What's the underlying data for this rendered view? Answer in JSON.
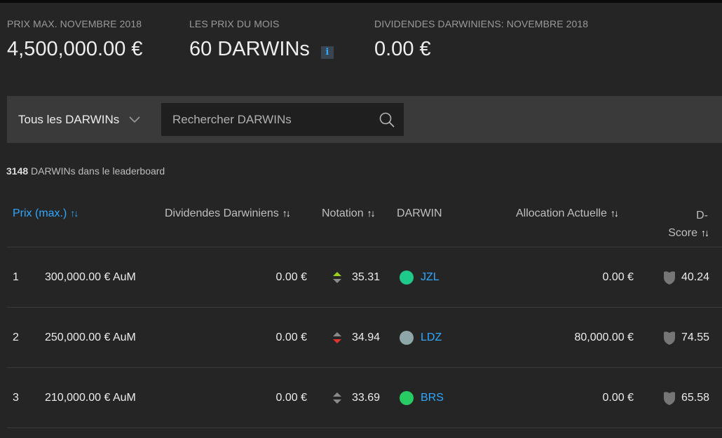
{
  "stats": {
    "max_prize": {
      "label": "PRIX MAX. NOVEMBRE 2018",
      "value": "4,500,000.00 €"
    },
    "month_prizes": {
      "label": "LES PRIX DU MOIS",
      "value": "60 DARWINs",
      "info_icon": "i"
    },
    "dividends": {
      "label": "DIVIDENDES DARWINIENS: NOVEMBRE 2018",
      "value": "0.00 €"
    }
  },
  "filter": {
    "dropdown_label": "Tous les DARWINs",
    "search_placeholder": "Rechercher DARWINs"
  },
  "leaderboard_count": {
    "number": "3148",
    "text": " DARWINs dans le leaderboard"
  },
  "columns": {
    "prize": "Prix (max.)",
    "dividends": "Dividendes Darwiniens",
    "rating": "Notation",
    "darwin": "DARWIN",
    "allocation": "Allocation Actuelle",
    "dscore_line1": "D-",
    "dscore_line2": "Score",
    "sort_glyph": "↑↓"
  },
  "colors": {
    "accent": "#2fa8ff",
    "up": "#9bd11e",
    "down": "#e2332f",
    "neutral": "#8a8a8a"
  },
  "rows": [
    {
      "rank": "1",
      "prize": "300,000.00 € AuM",
      "dividends": "0.00 €",
      "trend": "up",
      "rating": "35.31",
      "dot_color": "#1fc98b",
      "ticker": "JZL",
      "allocation": "0.00 €",
      "dscore": "40.24"
    },
    {
      "rank": "2",
      "prize": "250,000.00 € AuM",
      "dividends": "0.00 €",
      "trend": "down",
      "rating": "34.94",
      "dot_color": "#8fa6a8",
      "ticker": "LDZ",
      "allocation": "80,000.00 €",
      "dscore": "74.55"
    },
    {
      "rank": "3",
      "prize": "210,000.00 € AuM",
      "dividends": "0.00 €",
      "trend": "neutral",
      "rating": "33.69",
      "dot_color": "#27cc62",
      "ticker": "BRS",
      "allocation": "0.00 €",
      "dscore": "65.58"
    }
  ]
}
